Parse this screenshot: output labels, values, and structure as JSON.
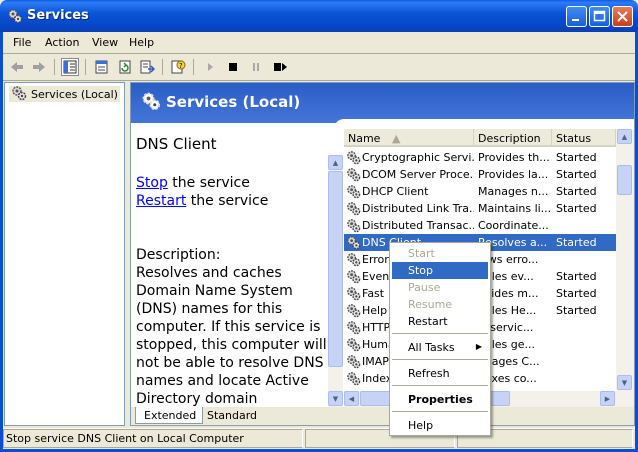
{
  "window": {
    "title": "Services"
  },
  "menu": [
    "File",
    "Action",
    "View",
    "Help"
  ],
  "tree": {
    "root_label": "Services (Local)"
  },
  "banner": {
    "title": "Services (Local)"
  },
  "extended": {
    "service_title": "DNS Client",
    "stop_link": "Stop",
    "stop_suffix": " the service",
    "restart_link": "Restart",
    "restart_suffix": " the service",
    "description_lines": [
      "Description:",
      "Resolves and caches",
      "Domain Name System",
      "(DNS) names for this",
      "computer. If this service is",
      "stopped, this computer will",
      "not be able to resolve DNS",
      "names and locate Active",
      "Directory domain"
    ]
  },
  "list": {
    "headers": {
      "name": "Name",
      "description": "Description",
      "status": "Status"
    },
    "rows": [
      {
        "name": "Cryptographic Servi...",
        "description": "Provides th...",
        "status": "Started"
      },
      {
        "name": "DCOM Server Proce...",
        "description": "Provides la...",
        "status": "Started"
      },
      {
        "name": "DHCP Client",
        "description": "Manages n...",
        "status": "Started"
      },
      {
        "name": "Distributed Link Tra...",
        "description": "Maintains li...",
        "status": "Started"
      },
      {
        "name": "Distributed Transac...",
        "description": "Coordinate...",
        "status": ""
      },
      {
        "name": "DNS Client",
        "description": "Resolves a...",
        "status": "Started"
      },
      {
        "name": "Error",
        "description": "lows erro...",
        "status": ""
      },
      {
        "name": "Even",
        "description": "ables ev...",
        "status": "Started"
      },
      {
        "name": "Fast",
        "description": "ovides m...",
        "status": "Started"
      },
      {
        "name": "Help",
        "description": "ables He...",
        "status": "Started"
      },
      {
        "name": "HTTP",
        "description": "is servic...",
        "status": ""
      },
      {
        "name": "Huma",
        "description": "ables ge...",
        "status": ""
      },
      {
        "name": "IMAP",
        "description": "anages C...",
        "status": ""
      },
      {
        "name": "Index",
        "description": "dexes co...",
        "status": ""
      }
    ],
    "selected_index": 5
  },
  "tabs": [
    "Extended",
    "Standard"
  ],
  "context_menu": {
    "start": "Start",
    "stop": "Stop",
    "pause": "Pause",
    "resume": "Resume",
    "restart": "Restart",
    "all_tasks": "All Tasks",
    "refresh": "Refresh",
    "properties": "Properties",
    "help": "Help"
  },
  "status_bar": {
    "text": "Stop service DNS Client on Local Computer"
  },
  "colors": {
    "titlebar": "#0a55d8",
    "selection": "#316ac5",
    "link": "#0000ff",
    "banner": "#2a5dc5"
  },
  "icons": [
    "gear-icon",
    "back-icon",
    "forward-icon",
    "show-tree-icon",
    "properties-icon",
    "refresh-icon",
    "export-icon",
    "help-icon",
    "play-icon",
    "stop-icon",
    "pause-icon",
    "restart-icon"
  ]
}
